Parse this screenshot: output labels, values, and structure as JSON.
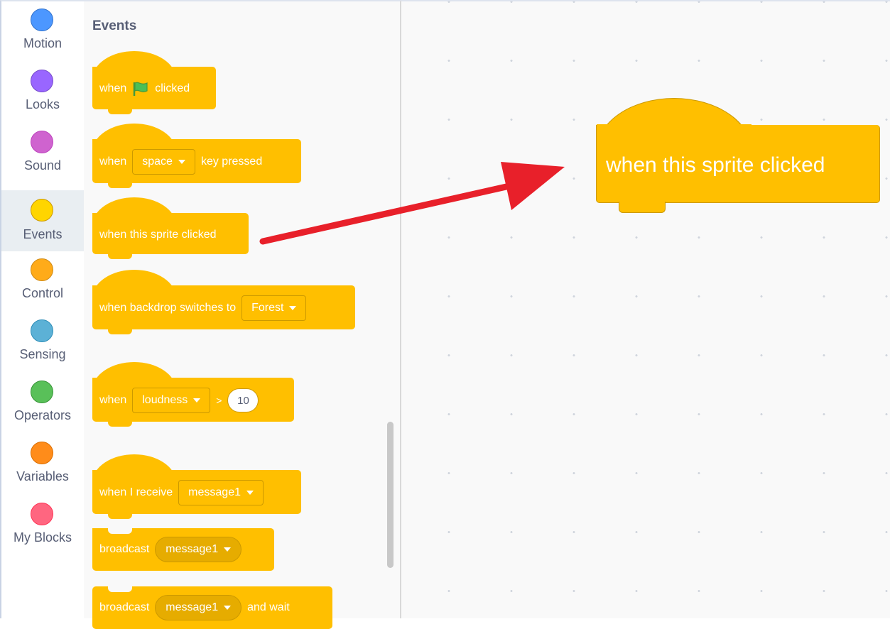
{
  "categories": [
    {
      "label": "Motion",
      "color": "#4c97ff",
      "border": "#3373cc"
    },
    {
      "label": "Looks",
      "color": "#9966ff",
      "border": "#774dcb"
    },
    {
      "label": "Sound",
      "color": "#cf63cf",
      "border": "#bd42bd"
    },
    {
      "label": "Events",
      "color": "#ffd500",
      "border": "#cc9900"
    },
    {
      "label": "Control",
      "color": "#ffab19",
      "border": "#cf8b17"
    },
    {
      "label": "Sensing",
      "color": "#5cb1d6",
      "border": "#2e8eb8"
    },
    {
      "label": "Operators",
      "color": "#59c059",
      "border": "#389438"
    },
    {
      "label": "Variables",
      "color": "#ff8c1a",
      "border": "#db6e00"
    },
    {
      "label": "My Blocks",
      "color": "#ff6680",
      "border": "#ff3355"
    }
  ],
  "selected_category": "Events",
  "palette": {
    "title": "Events",
    "blocks": {
      "flag": {
        "when": "when",
        "clicked": "clicked"
      },
      "key": {
        "when": "when",
        "key": "space",
        "pressed": "key pressed"
      },
      "sprite": {
        "text": "when this sprite clicked"
      },
      "backdrop": {
        "text": "when backdrop switches to",
        "value": "Forest"
      },
      "loudness": {
        "when": "when",
        "sensor": "loudness",
        "op": ">",
        "value": "10"
      },
      "receive": {
        "text": "when I receive",
        "value": "message1"
      },
      "broadcast": {
        "text": "broadcast",
        "value": "message1"
      },
      "broadcast_wait": {
        "text": "broadcast",
        "value": "message1",
        "suffix": "and wait"
      }
    }
  },
  "workspace": {
    "block": {
      "text": "when this sprite clicked"
    }
  },
  "colors": {
    "block": "#ffbf00",
    "block_border": "#cc9900",
    "arrow": "#e8202a",
    "flag": "#4cbf56"
  },
  "icons": {
    "flag": "green-flag-icon",
    "dropdown": "caret-down-icon"
  }
}
